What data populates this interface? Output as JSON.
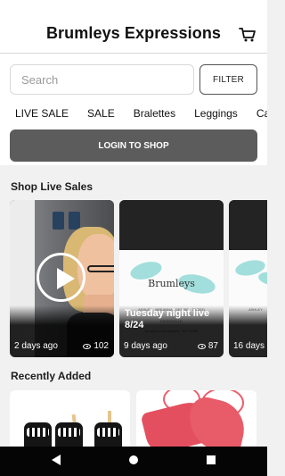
{
  "header": {
    "title": "Brumleys Expressions",
    "cart_icon": "cart-icon"
  },
  "search": {
    "placeholder": "Search",
    "filter_label": "FILTER"
  },
  "categories": [
    "LIVE SALE",
    "SALE",
    "Bralettes",
    "Leggings",
    "Cami"
  ],
  "login": {
    "label": "LOGIN TO SHOP"
  },
  "shop_live_sales": {
    "title": "Shop Live Sales",
    "cards": [
      {
        "caption": "",
        "age": "2 days ago",
        "views": "102",
        "play_icon": "play-icon",
        "view_icon": "eye-icon"
      },
      {
        "caption": "Tuesday night live 8/24",
        "age": "9 days ago",
        "views": "87",
        "view_icon": "eye-icon"
      },
      {
        "caption": "",
        "age": "16 days",
        "views": ""
      }
    ]
  },
  "recently_added": {
    "title": "Recently Added"
  },
  "system_nav": {
    "back_icon": "back-icon",
    "home_icon": "home-icon",
    "recent_apps_icon": "recent-apps-icon"
  },
  "colors": {
    "background": "#f1f1f1",
    "header_background": "#ffffff",
    "login_button": "#5c5c5c",
    "accent_teal": "#59c7c3",
    "system_bar": "#050505"
  }
}
